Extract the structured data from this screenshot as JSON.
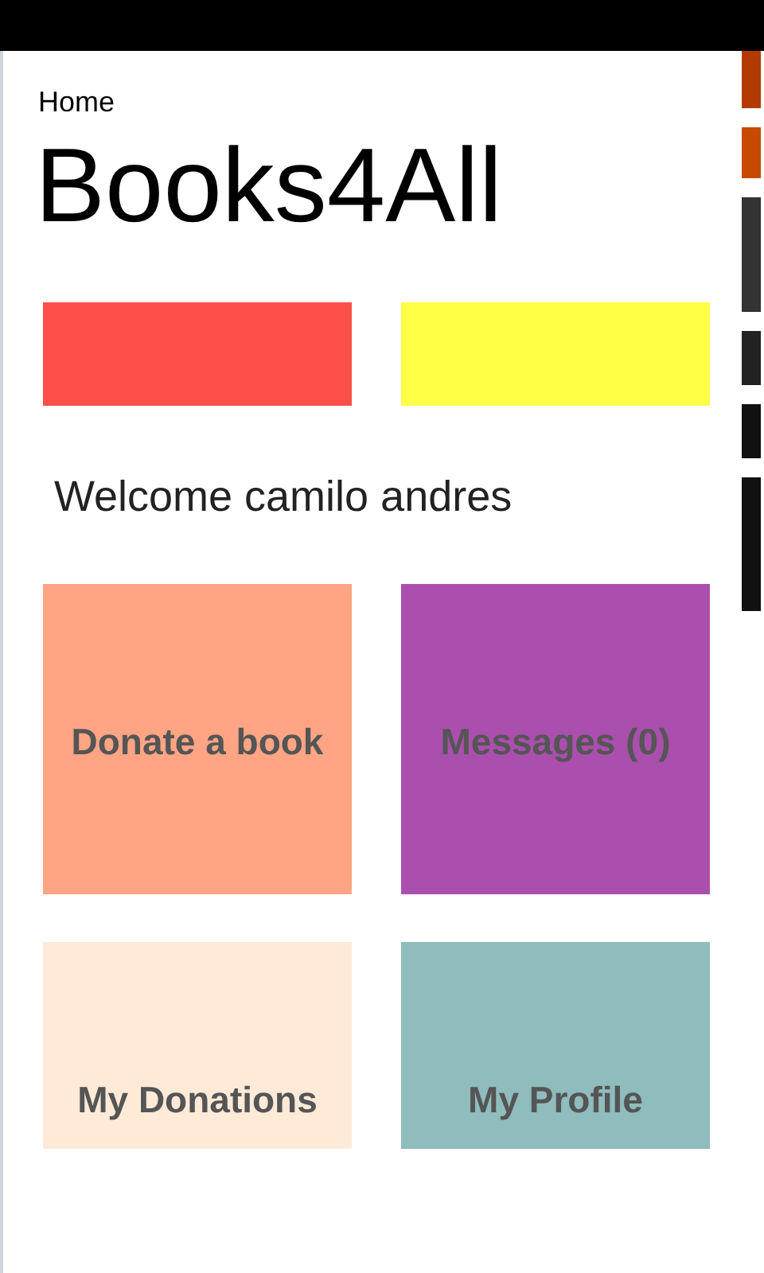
{
  "header": {
    "breadcrumb": "Home",
    "title": "Books4All"
  },
  "color_tiles": [
    {
      "color": "#ff4f4b"
    },
    {
      "color": "#ffff45"
    }
  ],
  "welcome": "Welcome camilo andres",
  "tiles": [
    {
      "label": "Donate a book",
      "color": "#ffa584"
    },
    {
      "label": "Messages (0)",
      "color": "#aa4fae"
    },
    {
      "label": "My Donations",
      "color": "#ffead8"
    },
    {
      "label": "My Profile",
      "color": "#8fbcbc"
    }
  ]
}
